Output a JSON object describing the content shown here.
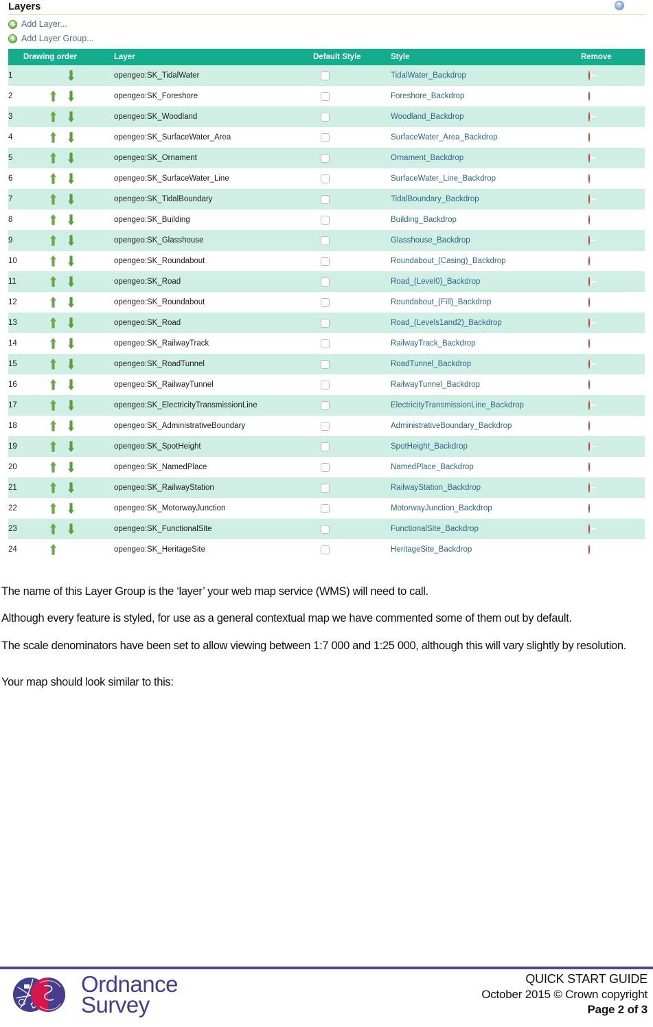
{
  "panel": {
    "title": "Layers",
    "help_icon": "help-icon",
    "add_layer_label": "Add Layer...",
    "add_layer_group_label": "Add Layer Group..."
  },
  "table": {
    "columns": [
      "",
      "Drawing order",
      "Layer",
      "Default Style",
      "Style",
      "Remove"
    ],
    "headers": {
      "order": "",
      "drawing_order": "Drawing order",
      "layer": "Layer",
      "default_style": "Default Style",
      "style": "Style",
      "remove": "Remove"
    },
    "header_bg": "#13ad8e",
    "odd_row_bg": "#cfeee4",
    "even_row_bg": "#ffffff",
    "style_link_color": "#2c6788",
    "rows": [
      {
        "order": "1",
        "up": false,
        "down": true,
        "layer": "opengeo:SK_TidalWater",
        "default_style": false,
        "style": "TidalWater_Backdrop"
      },
      {
        "order": "2",
        "up": true,
        "down": true,
        "layer": "opengeo:SK_Foreshore",
        "default_style": false,
        "style": "Foreshore_Backdrop"
      },
      {
        "order": "3",
        "up": true,
        "down": true,
        "layer": "opengeo:SK_Woodland",
        "default_style": false,
        "style": "Woodland_Backdrop"
      },
      {
        "order": "4",
        "up": true,
        "down": true,
        "layer": "opengeo:SK_SurfaceWater_Area",
        "default_style": false,
        "style": "SurfaceWater_Area_Backdrop"
      },
      {
        "order": "5",
        "up": true,
        "down": true,
        "layer": "opengeo:SK_Ornament",
        "default_style": false,
        "style": "Ornament_Backdrop"
      },
      {
        "order": "6",
        "up": true,
        "down": true,
        "layer": "opengeo:SK_SurfaceWater_Line",
        "default_style": false,
        "style": "SurfaceWater_Line_Backdrop"
      },
      {
        "order": "7",
        "up": true,
        "down": true,
        "layer": "opengeo:SK_TidalBoundary",
        "default_style": false,
        "style": "TidalBoundary_Backdrop"
      },
      {
        "order": "8",
        "up": true,
        "down": true,
        "layer": "opengeo:SK_Building",
        "default_style": false,
        "style": "Building_Backdrop"
      },
      {
        "order": "9",
        "up": true,
        "down": true,
        "layer": "opengeo:SK_Glasshouse",
        "default_style": false,
        "style": "Glasshouse_Backdrop"
      },
      {
        "order": "10",
        "up": true,
        "down": true,
        "layer": "opengeo:SK_Roundabout",
        "default_style": false,
        "style": "Roundabout_(Casing)_Backdrop"
      },
      {
        "order": "11",
        "up": true,
        "down": true,
        "layer": "opengeo:SK_Road",
        "default_style": false,
        "style": "Road_(Level0)_Backdrop"
      },
      {
        "order": "12",
        "up": true,
        "down": true,
        "layer": "opengeo:SK_Roundabout",
        "default_style": false,
        "style": "Roundabout_(Fill)_Backdrop"
      },
      {
        "order": "13",
        "up": true,
        "down": true,
        "layer": "opengeo:SK_Road",
        "default_style": false,
        "style": "Road_(Levels1and2)_Backdrop"
      },
      {
        "order": "14",
        "up": true,
        "down": true,
        "layer": "opengeo:SK_RailwayTrack",
        "default_style": false,
        "style": "RailwayTrack_Backdrop"
      },
      {
        "order": "15",
        "up": true,
        "down": true,
        "layer": "opengeo:SK_RoadTunnel",
        "default_style": false,
        "style": "RoadTunnel_Backdrop"
      },
      {
        "order": "16",
        "up": true,
        "down": true,
        "layer": "opengeo:SK_RailwayTunnel",
        "default_style": false,
        "style": "RailwayTunnel_Backdrop"
      },
      {
        "order": "17",
        "up": true,
        "down": true,
        "layer": "opengeo:SK_ElectricityTransmissionLine",
        "default_style": false,
        "style": "ElectricityTransmissionLine_Backdrop"
      },
      {
        "order": "18",
        "up": true,
        "down": true,
        "layer": "opengeo:SK_AdministrativeBoundary",
        "default_style": false,
        "style": "AdministrativeBoundary_Backdrop"
      },
      {
        "order": "19",
        "up": true,
        "down": true,
        "layer": "opengeo:SK_SpotHeight",
        "default_style": false,
        "style": "SpotHeight_Backdrop"
      },
      {
        "order": "20",
        "up": true,
        "down": true,
        "layer": "opengeo:SK_NamedPlace",
        "default_style": false,
        "style": "NamedPlace_Backdrop"
      },
      {
        "order": "21",
        "up": true,
        "down": true,
        "layer": "opengeo:SK_RailwayStation",
        "default_style": false,
        "style": "RailwayStation_Backdrop"
      },
      {
        "order": "22",
        "up": true,
        "down": true,
        "layer": "opengeo:SK_MotorwayJunction",
        "default_style": false,
        "style": "MotorwayJunction_Backdrop"
      },
      {
        "order": "23",
        "up": true,
        "down": true,
        "layer": "opengeo:SK_FunctionalSite",
        "default_style": false,
        "style": "FunctionalSite_Backdrop"
      },
      {
        "order": "24",
        "up": true,
        "down": false,
        "layer": "opengeo:SK_HeritageSite",
        "default_style": false,
        "style": "HeritageSite_Backdrop"
      }
    ]
  },
  "body": {
    "paragraphs": [
      "The name of this Layer Group is the ‘layer’ your web map service (WMS) will need to call.",
      "Although every feature is styled, for use as a general contextual map we have commented some of them out by default.",
      "The scale denominators have been set to allow viewing between 1:7 000 and 1:25 000, although this will vary slightly by resolution.",
      "Your map should look similar to this:"
    ]
  },
  "footer": {
    "logo_line1": "Ordnance",
    "logo_line2": "Survey",
    "guide_label": "QUICK START GUIDE",
    "copyright": "October 2015  © Crown copyright",
    "page": "Page 2 of 3",
    "rule_color": "#4a4a91",
    "brand_color": "#3f3f8f"
  }
}
